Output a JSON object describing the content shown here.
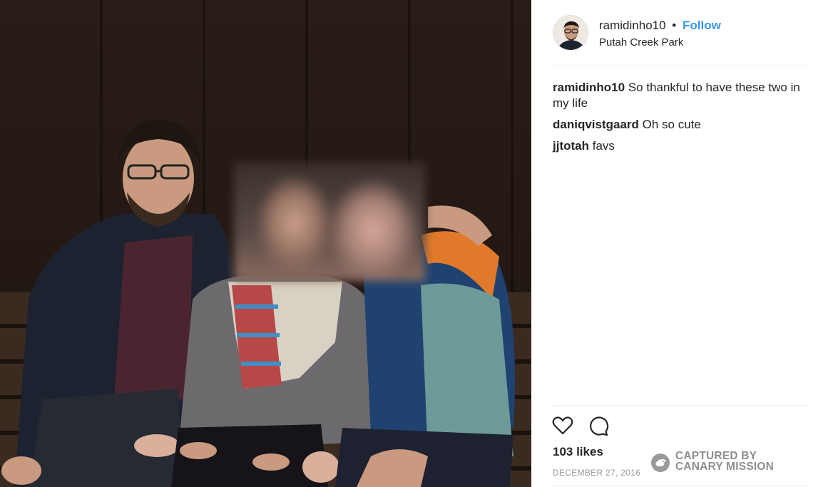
{
  "post": {
    "username": "ramidinho10",
    "separator": "•",
    "follow_label": "Follow",
    "location": "Putah Creek Park",
    "avatar_icon": "user-avatar",
    "photo_alt": "photo"
  },
  "comments": [
    {
      "user": "ramidinho10",
      "text": "So thankful to have these two in my life"
    },
    {
      "user": "daniqvistgaard",
      "text": "Oh so cute"
    },
    {
      "user": "jjtotah",
      "text": "favs"
    }
  ],
  "actions": {
    "like_icon": "heart-icon",
    "comment_icon": "comment-icon"
  },
  "likes_label": "103 likes",
  "date_label": "DECEMBER 27, 2016",
  "watermark": {
    "line1": "CAPTURED BY",
    "line2": "CANARY MISSION"
  },
  "colors": {
    "follow": "#3897f0",
    "text": "#262626",
    "muted": "#999999",
    "divider": "#efefef"
  }
}
